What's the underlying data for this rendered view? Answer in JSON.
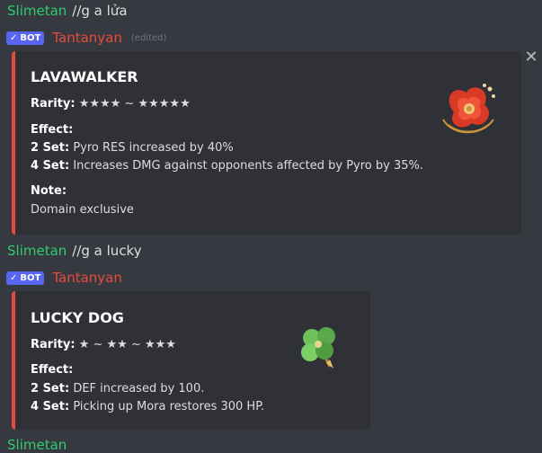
{
  "messages": [
    {
      "user": "Slimetan",
      "command": "//g a lửa",
      "bot_badge": "BOT",
      "bot_name": "Tantanyan",
      "edited": "(edited)",
      "embed": {
        "title": "LAVAWALKER",
        "rarity_label": "Rarity:",
        "rarity_value": "★★★★ ~ ★★★★★",
        "effect_label": "Effect:",
        "set2_label": "2 Set:",
        "set2_text": "Pyro RES increased by 40%",
        "set4_label": "4 Set:",
        "set4_text": "Increases DMG against opponents affected by Pyro by 35%.",
        "note_label": "Note:",
        "note_text": "Domain exclusive",
        "thumbnail": "red-flower-artifact-icon"
      }
    },
    {
      "user": "Slimetan",
      "command": "//g a lucky",
      "bot_badge": "BOT",
      "bot_name": "Tantanyan",
      "embed": {
        "title": "LUCKY DOG",
        "rarity_label": "Rarity:",
        "rarity_value": "★ ~ ★★ ~ ★★★",
        "effect_label": "Effect:",
        "set2_label": "2 Set:",
        "set2_text": "DEF increased by 100.",
        "set4_label": "4 Set:",
        "set4_text": "Picking up Mora restores 300 HP.",
        "thumbnail": "clover-artifact-icon"
      }
    }
  ],
  "colors": {
    "background": "#36393f",
    "embed_bg": "#2f3136",
    "embed_border": "#e74c3c",
    "user_name": "#2ecc71",
    "bot_name": "#e74c3c",
    "bot_badge": "#5865f2"
  },
  "icons": {
    "close": "close-icon",
    "badge_check": "check-icon"
  }
}
